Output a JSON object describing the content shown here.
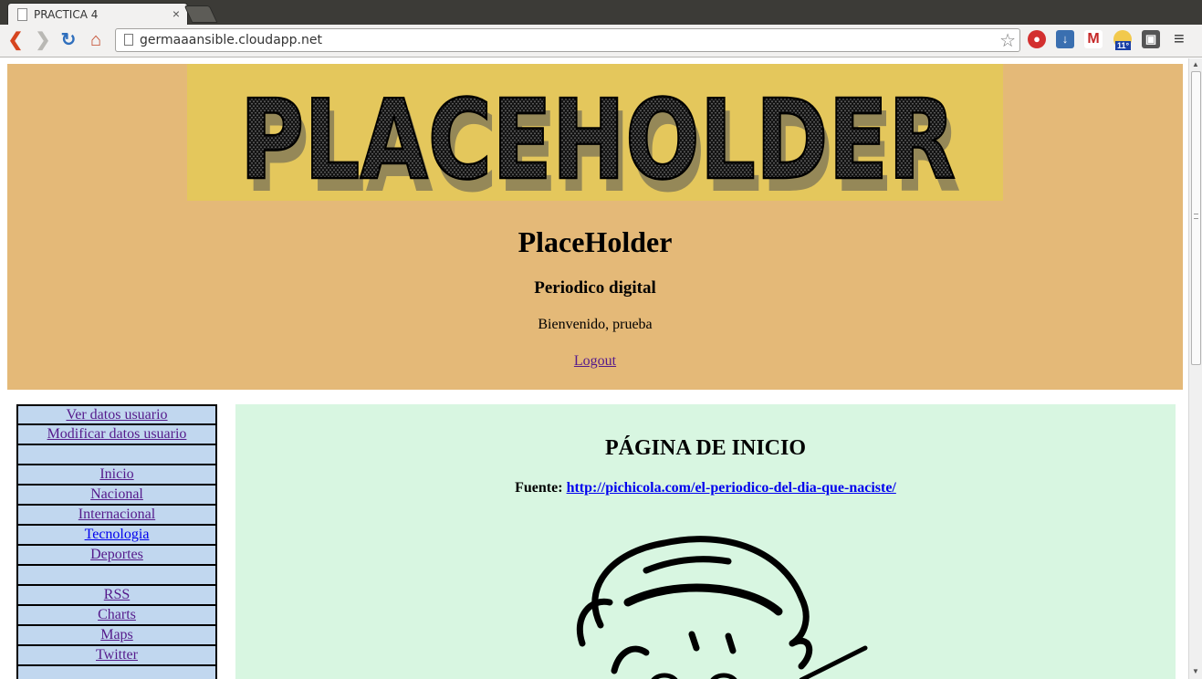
{
  "browser": {
    "tab_title": "PRACTICA 4",
    "tab_close": "×",
    "url": "germaaansible.cloudapp.net",
    "weather_temp": "11°"
  },
  "header": {
    "logo_text": "PLACEHOLDER",
    "title": "PlaceHolder",
    "subtitle": "Periodico digital",
    "welcome": "Bienvenido, prueba",
    "logout": "Logout "
  },
  "sidebar": {
    "items": [
      {
        "label": "Ver datos usuario"
      },
      {
        "label": "Modificar datos usuario"
      },
      {
        "label": ""
      },
      {
        "label": "Inicio"
      },
      {
        "label": "Nacional"
      },
      {
        "label": "Internacional"
      },
      {
        "label": "Tecnologia"
      },
      {
        "label": "Deportes"
      },
      {
        "label": ""
      },
      {
        "label": "RSS"
      },
      {
        "label": "Charts"
      },
      {
        "label": "Maps"
      },
      {
        "label": "Twitter"
      },
      {
        "label": ""
      }
    ]
  },
  "main": {
    "title": "PÁGINA DE INICIO",
    "source_label": "Fuente:",
    "source_link": "http://pichicola.com/el-periodico-del-dia-que-naciste/"
  },
  "colors": {
    "header_bg": "#e4b978",
    "banner_bg": "#e4c75c",
    "sidebar_bg": "#c1d7ef",
    "content_bg": "#d8f6e1",
    "visited_link": "#551a8b",
    "link": "#0000ee"
  }
}
